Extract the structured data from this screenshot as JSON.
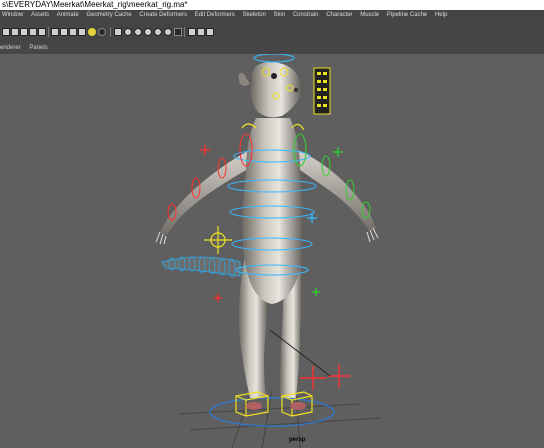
{
  "window": {
    "title": "s\\EVERYDAY\\Meerkat\\Meerkat_rig\\meerkat_rig.ma*"
  },
  "menu": [
    "Window",
    "Assets",
    "Animate",
    "Geometry Cache",
    "Create Deformers",
    "Edit Deformers",
    "Skeleton",
    "Skin",
    "Constrain",
    "Character",
    "Muscle",
    "Pipeline Cache",
    "Help"
  ],
  "panel_menu": [
    "enderer",
    "Panels"
  ],
  "viewport": {
    "camera_label": "persp"
  },
  "colors": {
    "menu_bg": "#444444",
    "viewport_bg": "#5f5f5f",
    "control_yellow": "#f0e020",
    "control_cyan": "#38b8ff",
    "control_red": "#ff3030",
    "control_green": "#30d030"
  }
}
